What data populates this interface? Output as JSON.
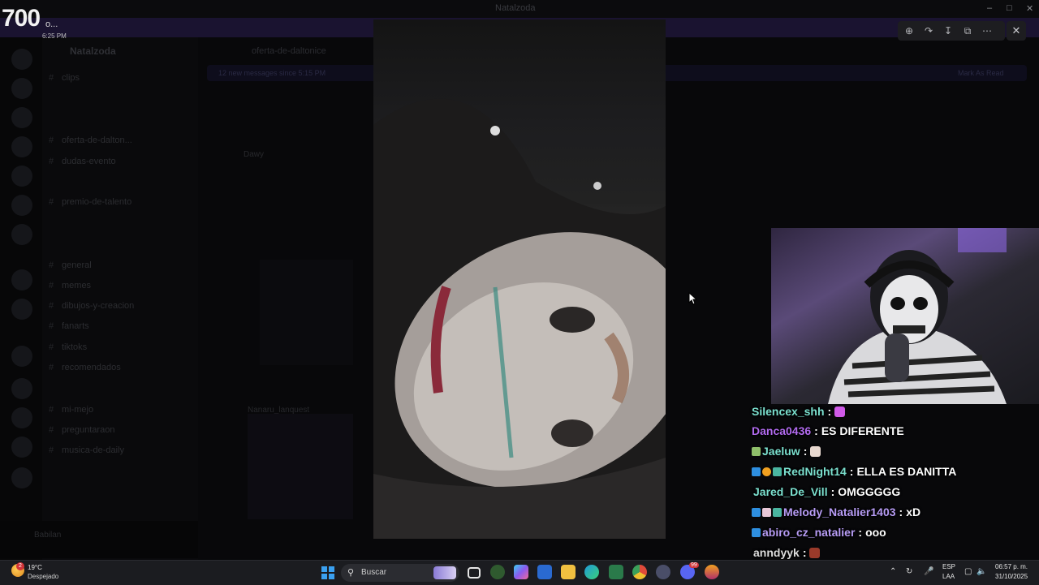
{
  "window": {
    "app_title": "Natalzoda",
    "controls": {
      "minimize": "–",
      "maximize": "□",
      "close": "✕"
    }
  },
  "notification": {
    "big_text": "700",
    "trailing": "o...",
    "time": "6:25 PM"
  },
  "discord": {
    "server_name": "Natalzoda",
    "channel_title": "oferta-de-daltonice",
    "new_messages_text": "12 new messages since 5:15 PM",
    "mark_read": "Mark As Read",
    "channels": [
      {
        "name": "clips",
        "icon": "#"
      },
      {
        "name": "oferta-de-dalton...",
        "icon": "#"
      },
      {
        "name": "dudas-evento",
        "icon": "#"
      },
      {
        "name": "premio-de-talento",
        "icon": "#"
      },
      {
        "name": "general",
        "icon": "#"
      },
      {
        "name": "memes",
        "icon": "#"
      },
      {
        "name": "dibujos-y-creacion",
        "icon": "#"
      },
      {
        "name": "fanarts",
        "icon": "#"
      },
      {
        "name": "tiktoks",
        "icon": "#"
      },
      {
        "name": "recomendados",
        "icon": "#"
      },
      {
        "name": "mi-mejo",
        "icon": "#"
      },
      {
        "name": "preguntaraon",
        "icon": "#"
      },
      {
        "name": "musica-de-daily",
        "icon": "#"
      }
    ],
    "message_preview": "Dawy",
    "post_author": "Nanaru_lanquest",
    "user_name": "Babilan"
  },
  "viewer": {
    "tools": [
      "zoom-in-icon",
      "forward-icon",
      "download-icon",
      "open-external-icon",
      "more-icon"
    ],
    "close_label": "✕"
  },
  "chat": {
    "messages": [
      {
        "user": "Silencex_shh",
        "color": "#7be0cf",
        "badges": [],
        "text": "",
        "emote": "#d05ae8"
      },
      {
        "user": "Danca0436",
        "color": "#b26bf0",
        "badges": [],
        "text": "ES DIFERENTE",
        "emote": ""
      },
      {
        "user": "Jaeluw",
        "color": "#7be0cf",
        "badges": [
          "#8fbf6a"
        ],
        "text": "",
        "emote": "#e8d8d0"
      },
      {
        "user": "RedNight14",
        "color": "#7be0cf",
        "badges": [
          "#2e8fe0",
          "#f0a020",
          "#4ab5a0"
        ],
        "text": "ELLA ES DANITTA",
        "emote": ""
      },
      {
        "user": "Jared_De_Vill",
        "color": "#7be0cf",
        "badges": [],
        "text": "OMGGGGG",
        "emote": ""
      },
      {
        "user": "Melody_Natalier1403",
        "color": "#b79cf5",
        "badges": [
          "#2e8fe0",
          "#e8c8d8",
          "#4ab5a0"
        ],
        "text": "xD",
        "emote": ""
      },
      {
        "user": "abiro_cz_natalier",
        "color": "#b79cf5",
        "badges": [
          "#2e8fe0"
        ],
        "text": "ooo",
        "emote": ""
      },
      {
        "user": "anndyyk",
        "color": "#dcdcdc",
        "badges": [],
        "text": "",
        "emote": "#9a3a2a"
      }
    ]
  },
  "taskbar": {
    "weather": {
      "badge": "2",
      "temp": "19°C",
      "condition": "Despejado"
    },
    "search_placeholder": "Buscar",
    "pinned": [
      {
        "name": "task-view-icon",
        "color": "#e6e6e6"
      },
      {
        "name": "widgets-icon",
        "color": "#3a7a3a"
      },
      {
        "name": "copilot-icon",
        "color": "#6a8af0"
      },
      {
        "name": "store-icon",
        "color": "#2a6ad0"
      },
      {
        "name": "file-explorer-icon",
        "color": "#f0c040"
      },
      {
        "name": "edge-icon",
        "color": "#1f9ad8"
      },
      {
        "name": "excel-icon",
        "color": "#2a7a4a"
      },
      {
        "name": "chrome-icon",
        "color": "#e04a3a"
      },
      {
        "name": "steam-icon",
        "color": "#8a8ea8"
      },
      {
        "name": "discord-icon",
        "color": "#5865f2"
      },
      {
        "name": "app-icon",
        "color": "#e06a20"
      }
    ],
    "discord_badge": "99",
    "language": [
      "ESP",
      "LAA"
    ],
    "time": "06:57 p. m.",
    "date": "31/10/2025"
  }
}
